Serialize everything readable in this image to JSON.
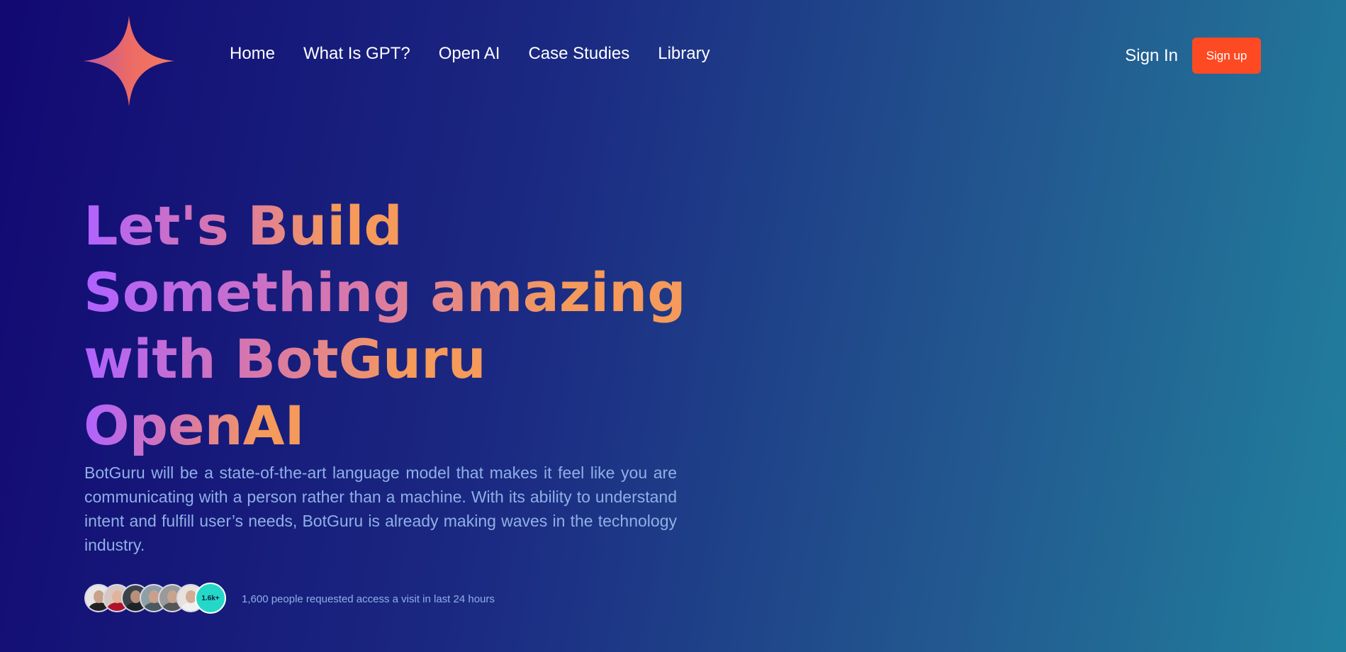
{
  "nav": {
    "items": [
      {
        "label": "Home"
      },
      {
        "label": "What Is GPT?"
      },
      {
        "label": "Open AI"
      },
      {
        "label": "Case Studies"
      },
      {
        "label": "Library"
      }
    ]
  },
  "auth": {
    "signin_label": "Sign In",
    "signup_label": "Sign up"
  },
  "hero": {
    "title_lines": [
      "Let's Build",
      "Something amazing",
      "with BotGuru",
      "OpenAI"
    ],
    "description": "BotGuru will be a state-of-the-art language model that makes it feel like you are communicating with a person rather than a machine. With its ability to understand intent and fulfill user’s needs, BotGuru is already making waves in the technology industry."
  },
  "social_proof": {
    "count_badge": "1.6k+",
    "text": "1,600 people requested access a visit in last 24 hours",
    "avatars": [
      {
        "icon": "user-avatar-icon",
        "bg": "#e6e6e6",
        "skin": "#c9a28a",
        "shirt": "#222222"
      },
      {
        "icon": "user-avatar-icon",
        "bg": "#d8c7c0",
        "skin": "#e0b49c",
        "shirt": "#b0122a"
      },
      {
        "icon": "user-avatar-icon",
        "bg": "#3a4448",
        "skin": "#b88f78",
        "shirt": "#1c2326"
      },
      {
        "icon": "user-avatar-icon",
        "bg": "#8ea0a6",
        "skin": "#caa08a",
        "shirt": "#4a5a60"
      },
      {
        "icon": "user-avatar-icon",
        "bg": "#9a9a9a",
        "skin": "#c7a48e",
        "shirt": "#555555"
      },
      {
        "icon": "user-avatar-icon",
        "bg": "#e8e2dc",
        "skin": "#d2ac94",
        "shirt": "#f0f0f0"
      }
    ]
  },
  "colors": {
    "accent": "#fd4a23",
    "badge": "#24d8c8",
    "text_muted": "#8fb0e6"
  },
  "logo": {
    "icon": "sparkle-star-icon"
  }
}
